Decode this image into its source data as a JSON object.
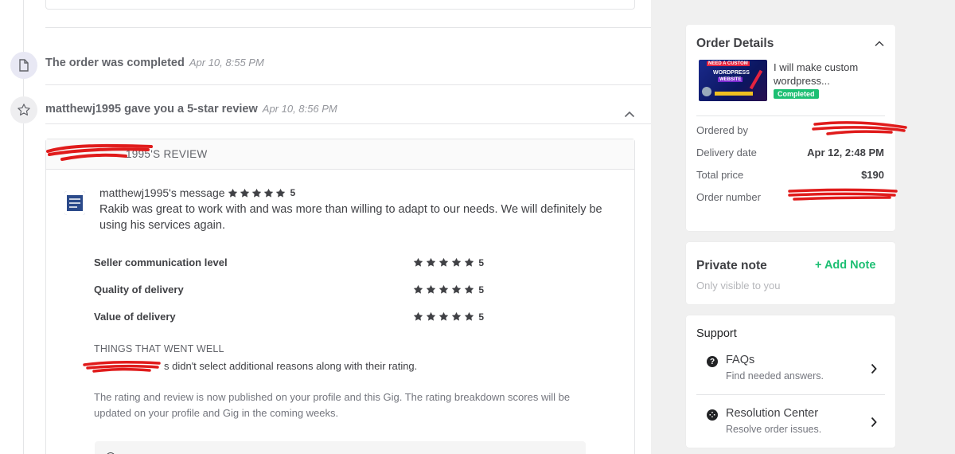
{
  "timeline": {
    "completed": {
      "title": "The order was completed",
      "time": "Apr 10, 8:55 PM",
      "icon": "document-icon"
    },
    "review": {
      "title": "matthewj1995 gave you a 5-star review",
      "time": "Apr 10, 8:56 PM",
      "icon": "star-icon"
    }
  },
  "review": {
    "header": "1995'S REVIEW",
    "message_title": "matthewj1995's message",
    "message_rating": "5",
    "message_body": "Rakib was great to work with and was more than willing to adapt to our needs. We will definitely be using his services again.",
    "ratings": [
      {
        "label": "Seller communication level",
        "value": "5",
        "stars": 5
      },
      {
        "label": "Quality of delivery",
        "value": "5",
        "stars": 5
      },
      {
        "label": "Value of delivery",
        "value": "5",
        "stars": 5
      }
    ],
    "went_well_title": "THINGS THAT WENT WELL",
    "went_well_text": "s didn't select additional reasons along with their rating.",
    "publish_note": "The rating and review is now published on your profile and this Gig. The rating breakdown scores will be updated on your profile and Gig in the coming weeks."
  },
  "order_details": {
    "title": "Order Details",
    "gig_title": "I will make custom wordpress...",
    "gig_image_text": {
      "line1": "NEED A CUSTOM",
      "line2": "WORDPRESS",
      "line3": "WEBSITE"
    },
    "status": "Completed",
    "rows": [
      {
        "label": "Ordered by",
        "value": ""
      },
      {
        "label": "Delivery date",
        "value": "Apr 12, 2:48 PM"
      },
      {
        "label": "Total price",
        "value": "$190"
      },
      {
        "label": "Order number",
        "value": ""
      }
    ]
  },
  "private_note": {
    "title": "Private note",
    "add_label": "+ Add Note",
    "subtitle": "Only visible to you"
  },
  "support": {
    "title": "Support",
    "items": [
      {
        "label": "FAQs",
        "sub": "Find needed answers.",
        "icon": "?"
      },
      {
        "label": "Resolution Center",
        "sub": "Resolve order issues.",
        "icon": "⁘"
      }
    ]
  },
  "colors": {
    "accent_green": "#1dbf73",
    "redaction_red": "#e01b1b",
    "sidebar_bg": "#f0f0f0"
  }
}
